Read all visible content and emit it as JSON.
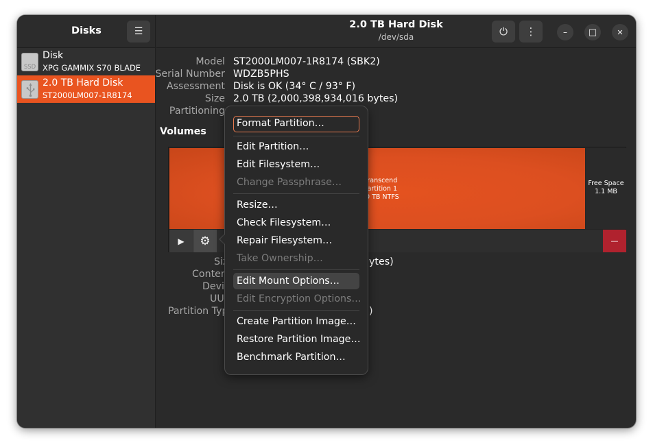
{
  "sidebar": {
    "title": "Disks",
    "disks": [
      {
        "name": "Disk",
        "subtitle": "XPG GAMMIX S70 BLADE",
        "icon_label": "SSD"
      },
      {
        "name": "2.0 TB Hard Disk",
        "subtitle": "ST2000LM007-1R8174",
        "icon_label": ""
      }
    ]
  },
  "header": {
    "title": "2.0 TB Hard Disk",
    "subtitle": "/dev/sda",
    "power_icon": "⏻",
    "kebab_icon": "⋮",
    "menu_icon": "☰",
    "minimize_icon": "–",
    "maximize_icon": "□",
    "close_icon": "✕"
  },
  "info": {
    "model_label": "Model",
    "model_value": "ST2000LM007-1R8174 (SBK2)",
    "serial_label": "Serial Number",
    "serial_value": "WDZB5PHS",
    "assessment_label": "Assessment",
    "assessment_value": "Disk is OK (34° C / 93° F)",
    "size_label": "Size",
    "size_value": "2.0 TB (2,000,398,934,016 bytes)",
    "partitioning_label": "Partitioning"
  },
  "volumes": {
    "heading": "Volumes",
    "partition_line1": "ranscend",
    "partition_line2": "artition 1",
    "partition_line3": "0 TB NTFS",
    "free_line1": "Free Space",
    "free_line2": "1.1 MB",
    "play_icon": "▶",
    "gear_icon": "⚙",
    "minus_icon": "—"
  },
  "details": {
    "size_label": "Siz",
    "size_frag": "ytes)",
    "contents_label": "Conten",
    "device_label": "Devi",
    "uuid_label": "UU",
    "partition_type_label": "Partition Typ",
    "partition_type_frag": ")"
  },
  "menu": {
    "items": [
      {
        "label": "Format Partition…",
        "state": "focused"
      },
      {
        "label": "Edit Partition…",
        "state": "normal"
      },
      {
        "label": "Edit Filesystem…",
        "state": "normal"
      },
      {
        "label": "Change Passphrase…",
        "state": "disabled"
      },
      {
        "label": "Resize…",
        "state": "normal"
      },
      {
        "label": "Check Filesystem…",
        "state": "normal"
      },
      {
        "label": "Repair Filesystem…",
        "state": "normal"
      },
      {
        "label": "Take Ownership…",
        "state": "disabled"
      },
      {
        "label": "Edit Mount Options…",
        "state": "hover"
      },
      {
        "label": "Edit Encryption Options…",
        "state": "disabled"
      },
      {
        "label": "Create Partition Image…",
        "state": "normal"
      },
      {
        "label": "Restore Partition Image…",
        "state": "normal"
      },
      {
        "label": "Benchmark Partition…",
        "state": "normal"
      }
    ]
  },
  "colors": {
    "accent": "#e95420",
    "destructive": "#b0222e",
    "background": "#2a2a2a"
  }
}
